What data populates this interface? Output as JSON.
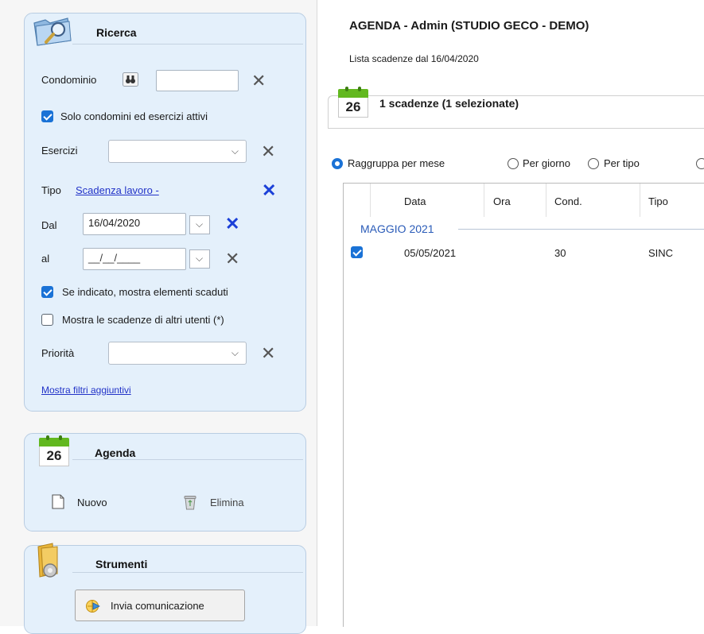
{
  "search_panel": {
    "title": "Ricerca",
    "condominio_label": "Condominio",
    "condominio_value": "",
    "solo_attivi_label": "Solo condomini ed esercizi attivi",
    "solo_attivi_checked": true,
    "esercizi_label": "Esercizi",
    "esercizi_value": "",
    "tipo_label": "Tipo",
    "tipo_value": "Scadenza lavoro -",
    "dal_label": "Dal",
    "dal_value": "16/04/2020",
    "al_label": "al",
    "al_value": "__/__/____",
    "mostra_scaduti_label": "Se indicato, mostra elementi scaduti",
    "mostra_scaduti_checked": true,
    "altri_utenti_label": "Mostra le scadenze di altri utenti (*)",
    "altri_utenti_checked": false,
    "priorita_label": "Priorità",
    "priorita_value": "",
    "more_filters_link": "Mostra filtri aggiuntivi"
  },
  "agenda_panel": {
    "calendar_day": "26",
    "title": "Agenda",
    "new_label": "Nuovo",
    "delete_label": "Elimina"
  },
  "tools_panel": {
    "title": "Strumenti",
    "send_button": "Invia comunicazione"
  },
  "main": {
    "title": "AGENDA - Admin (STUDIO GECO - DEMO)",
    "subtitle": "Lista scadenze dal 16/04/2020",
    "calendar_day": "26",
    "count_label": "1 scadenze (1 selezionate)",
    "grouping": {
      "selected": "Raggruppa per mese",
      "options": [
        "Raggruppa per mese",
        "Per giorno",
        "Per tipo"
      ]
    },
    "table": {
      "columns": [
        "Data",
        "Ora",
        "Cond.",
        "Tipo"
      ],
      "group_header": "MAGGIO 2021",
      "rows": [
        {
          "checked": true,
          "data": "05/05/2021",
          "ora": "",
          "cond": "30",
          "tipo": "SINC"
        }
      ]
    }
  },
  "colors": {
    "panel_bg": "#e4f0fb",
    "accent_blue": "#1a72d6",
    "link_blue": "#2233c8",
    "group_header": "#2a5bb8"
  }
}
